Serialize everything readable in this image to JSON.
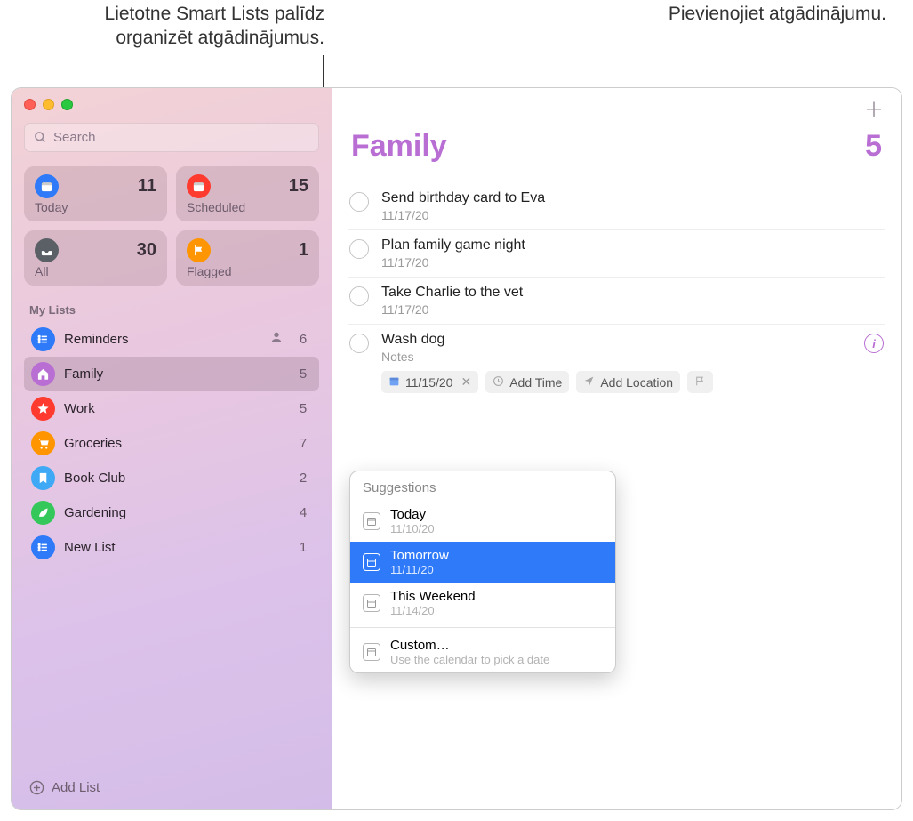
{
  "callouts": {
    "left": "Lietotne Smart Lists palīdz organizēt atgādinājumus.",
    "right": "Pievienojiet atgādinājumu."
  },
  "search": {
    "placeholder": "Search"
  },
  "smartLists": [
    {
      "id": "today",
      "label": "Today",
      "count": "11",
      "bg": "#2f7af8",
      "icon": "calendar-icon"
    },
    {
      "id": "scheduled",
      "label": "Scheduled",
      "count": "15",
      "bg": "#ff3b30",
      "icon": "calendar-icon"
    },
    {
      "id": "all",
      "label": "All",
      "count": "30",
      "bg": "#5b6067",
      "icon": "tray-icon"
    },
    {
      "id": "flagged",
      "label": "Flagged",
      "count": "1",
      "bg": "#ff9500",
      "icon": "flag-icon"
    }
  ],
  "sectionHead": "My Lists",
  "lists": [
    {
      "name": "Reminders",
      "count": "6",
      "bg": "#2f7af8",
      "icon": "list-icon",
      "shared": true
    },
    {
      "name": "Family",
      "count": "5",
      "bg": "#b86ed3",
      "icon": "home-icon",
      "selected": true
    },
    {
      "name": "Work",
      "count": "5",
      "bg": "#ff3b30",
      "icon": "star-icon"
    },
    {
      "name": "Groceries",
      "count": "7",
      "bg": "#ff9500",
      "icon": "cart-icon"
    },
    {
      "name": "Book Club",
      "count": "2",
      "bg": "#3fa9f5",
      "icon": "bookmark-icon"
    },
    {
      "name": "Gardening",
      "count": "4",
      "bg": "#34c759",
      "icon": "leaf-icon"
    },
    {
      "name": "New List",
      "count": "1",
      "bg": "#2f7af8",
      "icon": "list-icon"
    }
  ],
  "addList": "Add List",
  "header": {
    "title": "Family",
    "count": "5"
  },
  "reminders": [
    {
      "title": "Send birthday card to Eva",
      "sub": "11/17/20"
    },
    {
      "title": "Plan family game night",
      "sub": "11/17/20"
    },
    {
      "title": "Take Charlie to the vet",
      "sub": "11/17/20"
    }
  ],
  "editing": {
    "title": "Wash dog",
    "notesPlaceholder": "Notes",
    "dateChip": "11/15/20",
    "addTime": "Add Time",
    "addLocation": "Add Location"
  },
  "popover": {
    "head": "Suggestions",
    "items": [
      {
        "top": "Today",
        "sub": "11/10/20"
      },
      {
        "top": "Tomorrow",
        "sub": "11/11/20",
        "selected": true
      },
      {
        "top": "This Weekend",
        "sub": "11/14/20"
      }
    ],
    "custom": {
      "top": "Custom…",
      "sub": "Use the calendar to pick a date"
    }
  }
}
